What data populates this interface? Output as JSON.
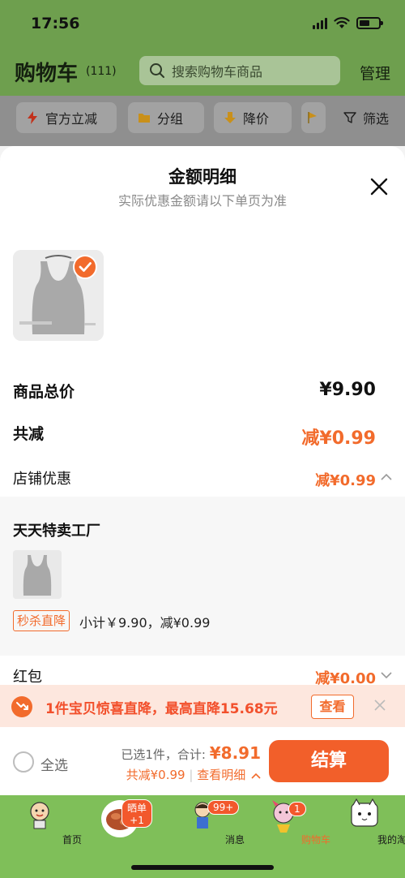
{
  "status_bar": {
    "time": "17:56"
  },
  "header": {
    "title": "购物车",
    "count": "(111)",
    "search_placeholder": "搜索购物车商品",
    "manage": "管理"
  },
  "filters": [
    {
      "label": "官方立减",
      "icon": "lightning-icon"
    },
    {
      "label": "分组",
      "icon": "folder-icon"
    },
    {
      "label": "降价",
      "icon": "price-drop-icon"
    },
    {
      "label": "",
      "icon": "flag-icon"
    },
    {
      "label": "筛选",
      "icon": "filter-icon"
    }
  ],
  "sheet": {
    "title": "金额明细",
    "subtitle": "实际优惠金额请以下单页为准",
    "total_price_label": "商品总价",
    "total_price": "¥9.90",
    "total_discount_label": "共减",
    "total_discount": "减¥0.99",
    "store_discount_label": "店铺优惠",
    "store_discount": "减¥0.99",
    "shop_name": "天天特卖工厂",
    "tag": "秒杀直降",
    "subtotal": "小计￥9.90，减¥0.99",
    "hongbao_label": "红包",
    "hongbao_value": "减¥0.00"
  },
  "promo": {
    "text": "1件宝贝惊喜直降，最高直降15.68元",
    "button": "查看"
  },
  "checkout": {
    "select_all": "全选",
    "selected_text": "已选1件，合计:",
    "total": "¥8.91",
    "discount_text": "共减¥0.99",
    "detail_link": "查看明细",
    "button": "结算"
  },
  "tabbar": [
    {
      "label": "首页",
      "icon": "home-mascot-icon"
    },
    {
      "label": "",
      "icon": "share-food-icon",
      "badge": "晒单+1"
    },
    {
      "label": "消息",
      "icon": "message-mascot-icon",
      "badge": "99+"
    },
    {
      "label": "购物车",
      "icon": "cart-mascot-icon",
      "badge": "1"
    },
    {
      "label": "我的淘宝",
      "icon": "profile-cat-icon"
    }
  ],
  "colors": {
    "accent": "#f26b2c",
    "header_green": "#6e9f4e",
    "tab_green": "#7fbf59"
  }
}
